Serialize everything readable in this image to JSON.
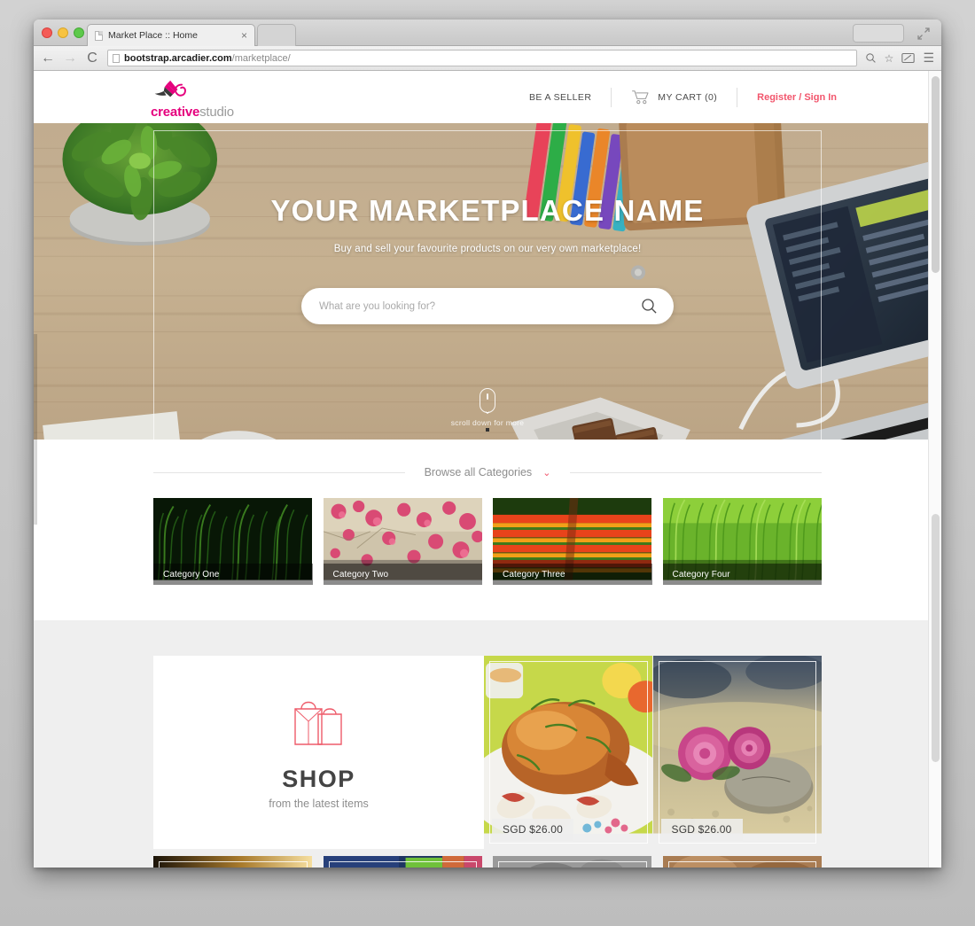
{
  "browser": {
    "tab_title": "Market Place :: Home",
    "tab_close": "×",
    "back_icon": "←",
    "forward_icon": "→",
    "reload_icon": "⟳",
    "url_strong": "bootstrap.arcadier.com",
    "url_dim": "/marketplace/",
    "search_icon": "search-icon",
    "bookmark_icon": "☆",
    "cast_icon": "cast-icon",
    "menu_icon": "☰",
    "expand_icon": "expand-icon"
  },
  "site_header": {
    "logo_primary": "creative",
    "logo_secondary": "studio",
    "nav": {
      "be_a_seller": "BE A SELLER",
      "cart": "MY CART (0)",
      "account": "Register / Sign In"
    }
  },
  "hero": {
    "title": "YOUR MARKETPLACE NAME",
    "subtitle": "Buy and sell your favourite products on our very own marketplace!",
    "search_placeholder": "What are you looking for?",
    "search_value": "",
    "scroll_hint": "scroll down for more"
  },
  "categories": {
    "browse_label": "Browse all Categories",
    "chevron": "⌄",
    "tiles": [
      {
        "label": "Category One"
      },
      {
        "label": "Category Two"
      },
      {
        "label": "Category Three"
      },
      {
        "label": "Category Four"
      }
    ]
  },
  "shop": {
    "title": "SHOP",
    "subtitle": "from the latest items",
    "icon": "shopping-bags-icon",
    "products": [
      {
        "price": "SGD $26.00"
      },
      {
        "price": "SGD $26.00"
      }
    ]
  },
  "colors": {
    "accent_pink": "#e5007d",
    "accent_red": "#f2556c",
    "text_dark": "#444444",
    "text_muted": "#8d8d8d"
  }
}
